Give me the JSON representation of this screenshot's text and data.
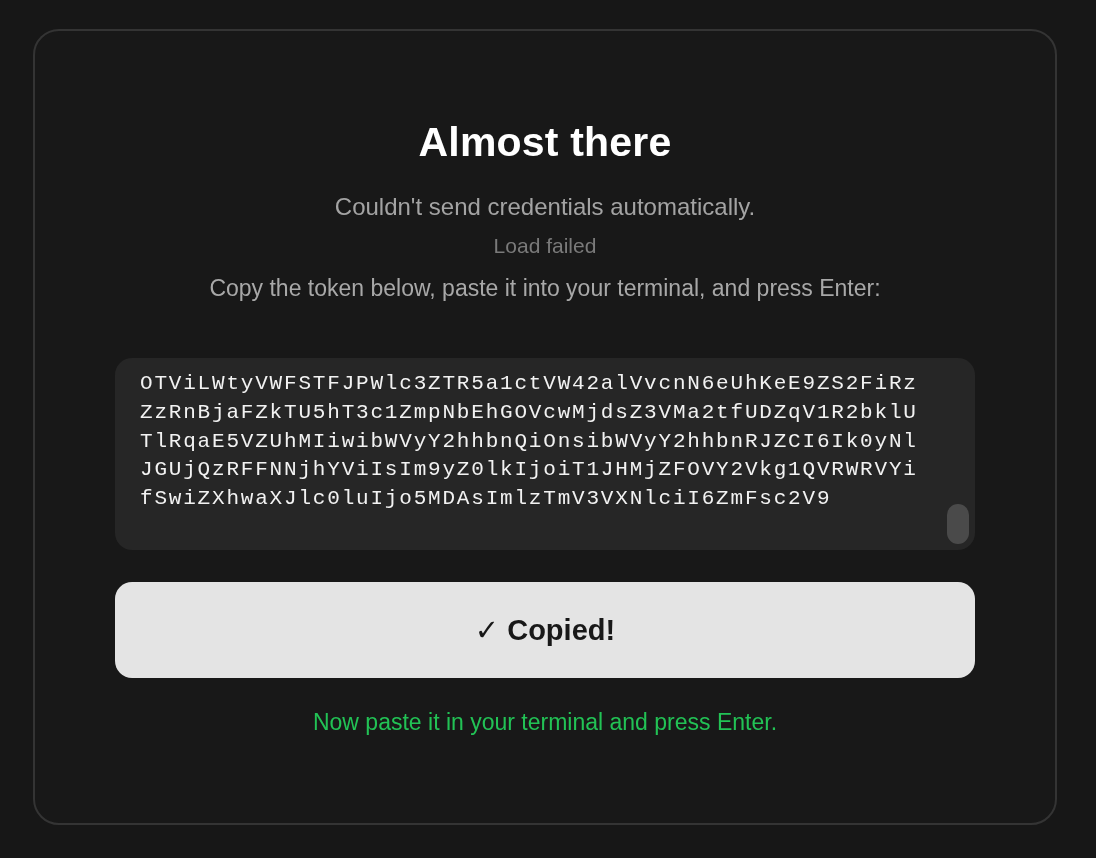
{
  "card": {
    "title": "Almost there",
    "subtitle": "Couldn't send credentials automatically.",
    "error": "Load failed",
    "instruction": "Copy the token below, paste it into your terminal, and press Enter:"
  },
  "token_field": {
    "value": "OTViLWtyVWFSTFJPWlc3ZTR5a1ctVW42alVvcnN6eUhKeE9ZS2FiRzZzRnBjaFZkTU5hT3c1ZmpNbEhGOVcwMjdsZ3VMa2tfUDZqV1R2bklUTlRqaE5VZUhMIiwibWVyY2hhbnQiOnsibWVyY2hhbnRJZCI6Ik0yNlJGUjQzRFFNNjhYViIsIm9yZ0lkIjoiT1JHMjZFOVY2Vkg1QVRWRVYifSwiZXhwaXJlc0luIjo5MDAsImlzTmV3VXNlciI6ZmFsc2V9"
  },
  "copy_button": {
    "label": "✓ Copied!"
  },
  "status": {
    "kind": "success",
    "text": "Now paste it in your terminal and press Enter."
  }
}
